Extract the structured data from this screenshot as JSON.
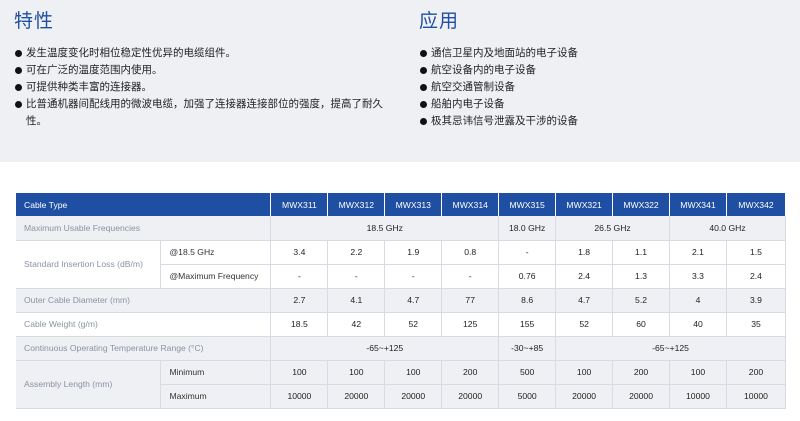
{
  "features": {
    "title": "特性",
    "items": [
      "发生温度变化时相位稳定性优异的电缆组件。",
      "可在广泛的温度范围内使用。",
      "可提供种类丰富的连接器。",
      "比普通机器间配线用的微波电缆，加强了连接器连接部位的强度，提高了耐久性。"
    ]
  },
  "applications": {
    "title": "应用",
    "items": [
      "通信卫星内及地面站的电子设备",
      "航空设备内的电子设备",
      "航空交通管制设备",
      "船舶内电子设备",
      "极其忌讳信号泄露及干涉的设备"
    ]
  },
  "table": {
    "header_label": "Cable Type",
    "models": [
      "MWX311",
      "MWX312",
      "MWX313",
      "MWX314",
      "MWX315",
      "MWX321",
      "MWX322",
      "MWX341",
      "MWX342"
    ],
    "freq": {
      "label": "Maximum Usable Frequencies",
      "g1": "18.5 GHz",
      "g2": "18.0 GHz",
      "g3": "26.5 GHz",
      "g4": "40.0 GHz"
    },
    "loss": {
      "label": "Standard Insertion Loss (dB/m)",
      "sub1": "@18.5 GHz",
      "row1": [
        "3.4",
        "2.2",
        "1.9",
        "0.8",
        "-",
        "1.8",
        "1.1",
        "2.1",
        "1.5"
      ],
      "sub2": "@Maximum Frequency",
      "row2": [
        "-",
        "-",
        "-",
        "-",
        "0.76",
        "2.4",
        "1.3",
        "3.3",
        "2.4"
      ]
    },
    "diameter": {
      "label": "Outer Cable Diameter (mm)",
      "values": [
        "2.7",
        "4.1",
        "4.7",
        "77",
        "8.6",
        "4.7",
        "5.2",
        "4",
        "3.9"
      ]
    },
    "weight": {
      "label": "Cable Weight (g/m)",
      "values": [
        "18.5",
        "42",
        "52",
        "125",
        "155",
        "52",
        "60",
        "40",
        "35"
      ]
    },
    "temp": {
      "label": "Continuous Operating Temperature Range (°C)",
      "g1": "-65~+125",
      "g2": "-30~+85",
      "g3": "-65~+125"
    },
    "assembly": {
      "label": "Assembly Length (mm)",
      "sub1": "Minimum",
      "min": [
        "100",
        "100",
        "100",
        "200",
        "500",
        "100",
        "200",
        "100",
        "200"
      ],
      "sub2": "Maximum",
      "max": [
        "10000",
        "20000",
        "20000",
        "20000",
        "5000",
        "20000",
        "20000",
        "10000",
        "10000"
      ]
    }
  }
}
